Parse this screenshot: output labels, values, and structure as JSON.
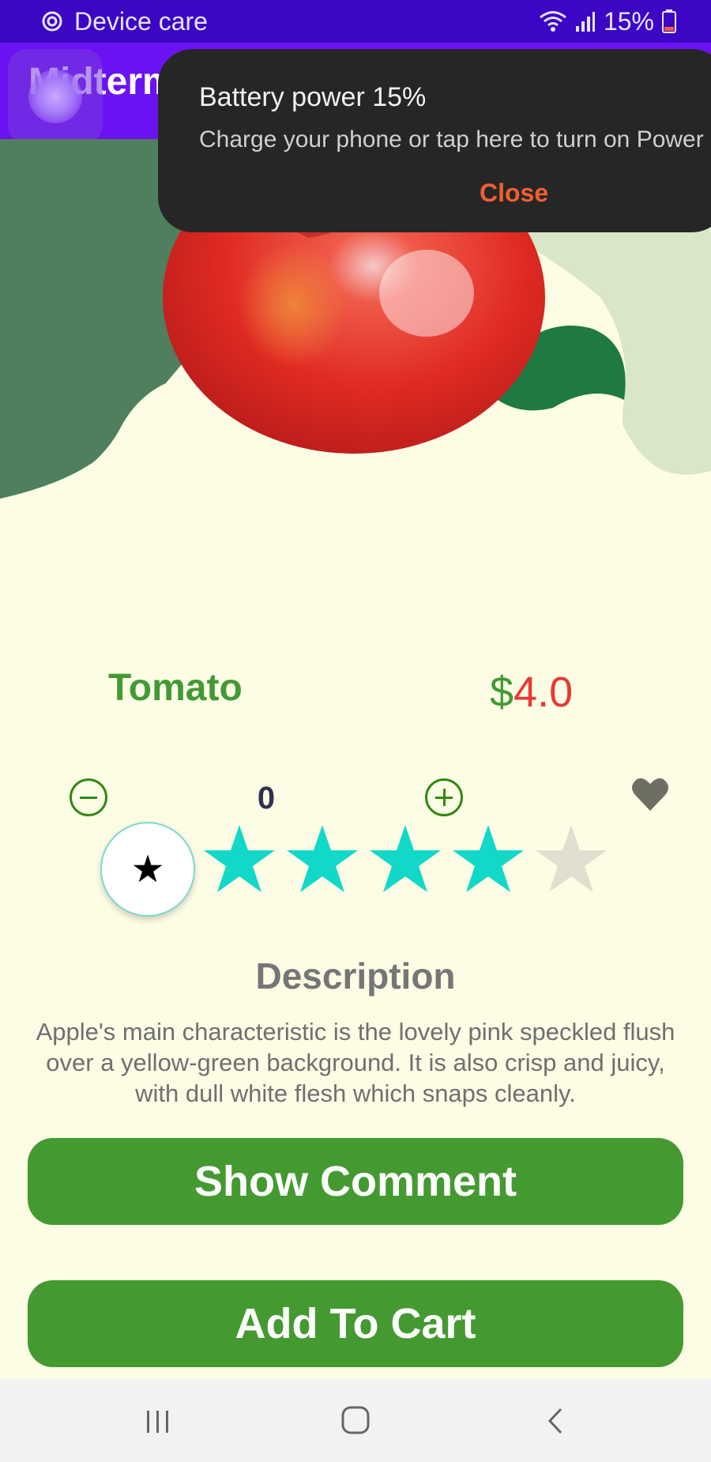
{
  "status_bar": {
    "app_label": "Device care",
    "battery_percent": "15%",
    "icons": [
      "device-care-icon",
      "wifi-icon",
      "signal-icon",
      "battery-low-icon"
    ]
  },
  "app_bar": {
    "title": "Midterm",
    "color": "#6b12f2"
  },
  "toast": {
    "title": "Battery power 15%",
    "message": "Charge your phone or tap here to turn on Power saving mode.",
    "close_label": "Close"
  },
  "product": {
    "name": "Tomato",
    "price_currency": "$",
    "price_value": "4.0",
    "quantity": "0",
    "rating": 4,
    "rating_max": 5,
    "rating_icon": "star-icon"
  },
  "description": {
    "heading": "Description",
    "text": "Apple's main characteristic is the lovely pink speckled flush over a yellow-green background. It is also crisp and juicy, with dull white flesh which snaps cleanly."
  },
  "buttons": {
    "show_comment": "Show Comment",
    "add_to_cart": "Add To Cart"
  },
  "colors": {
    "primary_green": "#449a30",
    "price_red": "#e83a32",
    "star_active": "#12d8c8",
    "star_inactive": "#e0dfd0",
    "background": "#fdfde5"
  }
}
